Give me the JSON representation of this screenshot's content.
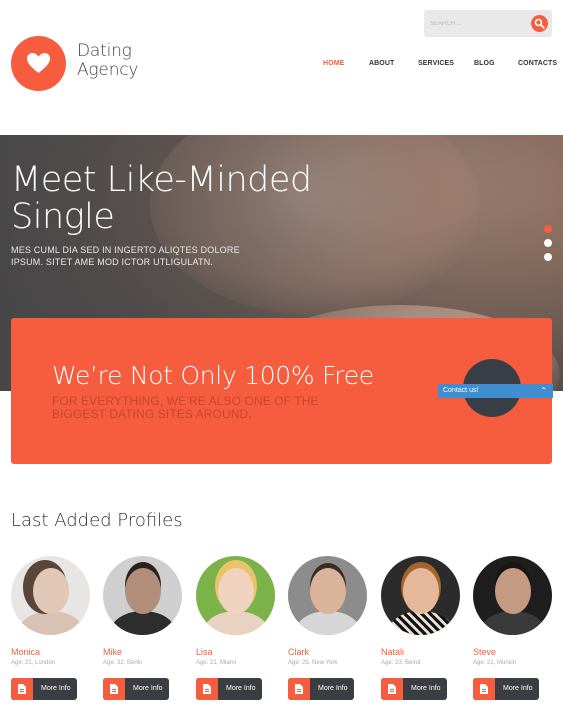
{
  "brand": {
    "line1": "Dating",
    "line2": "Agency",
    "icon": "heart-icon"
  },
  "search": {
    "placeholder": "SEARCH ...",
    "icon": "search-icon"
  },
  "nav": [
    {
      "label": "HOME",
      "active": true
    },
    {
      "label": "ABOUT",
      "active": false
    },
    {
      "label": "SERVICES",
      "active": false
    },
    {
      "label": "BLOG",
      "active": false
    },
    {
      "label": "CONTACTS",
      "active": false
    }
  ],
  "hero": {
    "title_line1": "Meet Like-Minded",
    "title_line2": "Single",
    "subtitle": "MES CUML DIA SED IN INGERTO ALIQTES DOLORE IPSUM. SITET AME MOD ICTOR UTLIGULATN.",
    "slides": 3,
    "active_slide": 1
  },
  "banner": {
    "title": "We’re Not Only 100% Free",
    "subtitle": "FOR EVERYTHING, WE’RE ALSO ONE OF THE BIGGEST DATING SITES AROUND."
  },
  "contact_widget": {
    "label": "Contact us!",
    "icon": "chevron-up-icon"
  },
  "profiles_section": {
    "title": "Last Added Profiles",
    "button_label": "More Info",
    "button_icon": "document-icon",
    "items": [
      {
        "name": "Monica",
        "meta": "Age: 21, London"
      },
      {
        "name": "Mike",
        "meta": "Age: 32, Berlin"
      },
      {
        "name": "Lisa",
        "meta": "Age: 21, Miami"
      },
      {
        "name": "Clark",
        "meta": "Age: 25, New York"
      },
      {
        "name": "Natali",
        "meta": "Age: 23, Beirut"
      },
      {
        "name": "Steve",
        "meta": "Age: 21, Munich"
      }
    ]
  },
  "colors": {
    "accent": "#f55d3e",
    "dark": "#3a3d42",
    "contact": "#3e8ed0"
  }
}
